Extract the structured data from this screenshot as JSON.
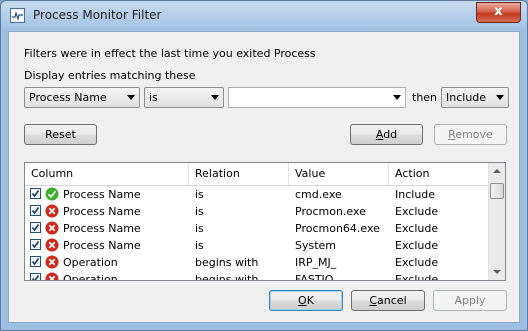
{
  "window": {
    "title": "Process Monitor Filter",
    "close_glyph": "x"
  },
  "intro_text": "Filters were in effect the last time you exited Process",
  "display_label": "Display entries matching these",
  "filter_row": {
    "column_value": "Process Name",
    "relation_value": "is",
    "value_text": "",
    "then_label": "then",
    "action_value": "Include"
  },
  "buttons": {
    "reset": "Reset",
    "add_prefix": "",
    "add_key": "A",
    "add_rest": "dd",
    "remove_prefix": "",
    "remove_key": "R",
    "remove_rest": "emove",
    "ok_prefix": "",
    "ok_key": "O",
    "ok_rest": "K",
    "cancel_prefix": "",
    "cancel_key": "C",
    "cancel_rest": "ancel",
    "apply": "Apply"
  },
  "list": {
    "headers": [
      "Column",
      "Relation",
      "Value",
      "Action"
    ],
    "rows": [
      {
        "checked": true,
        "status": "include",
        "column": "Process Name",
        "relation": "is",
        "value": "cmd.exe",
        "action": "Include"
      },
      {
        "checked": true,
        "status": "exclude",
        "column": "Process Name",
        "relation": "is",
        "value": "Procmon.exe",
        "action": "Exclude"
      },
      {
        "checked": true,
        "status": "exclude",
        "column": "Process Name",
        "relation": "is",
        "value": "Procmon64.exe",
        "action": "Exclude"
      },
      {
        "checked": true,
        "status": "exclude",
        "column": "Process Name",
        "relation": "is",
        "value": "System",
        "action": "Exclude"
      },
      {
        "checked": true,
        "status": "exclude",
        "column": "Operation",
        "relation": "begins with",
        "value": "IRP_MJ_",
        "action": "Exclude"
      },
      {
        "checked": true,
        "status": "exclude",
        "column": "Operation",
        "relation": "begins with",
        "value": "FASTIO_",
        "action": "Exclude"
      }
    ]
  },
  "colors": {
    "include_icon": "#3fae2a",
    "exclude_icon": "#d0281a"
  }
}
